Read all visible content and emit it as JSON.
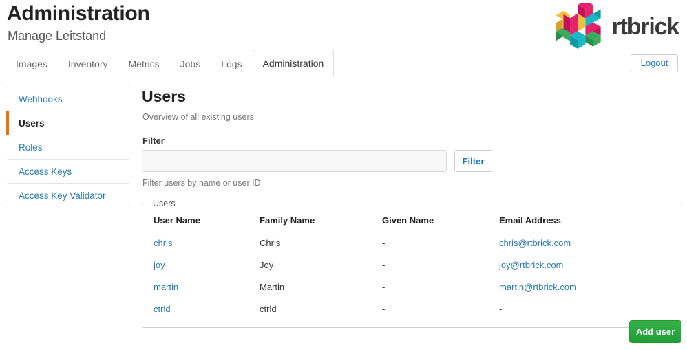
{
  "header": {
    "title": "Administration",
    "subtitle": "Manage Leitstand",
    "logout_label": "Logout"
  },
  "brand": {
    "wordmark": "rtbrick",
    "logo_icon": "rtbrick-cubes-logo",
    "colors": {
      "magenta": "#e5236b",
      "dark_magenta": "#c4105c",
      "cyan": "#18b8c8",
      "dark_cyan": "#0f9aa8",
      "yellow": "#f2c13c",
      "dark_yellow": "#d9a02c",
      "green": "#3aab5c",
      "dark_green": "#2a8f49"
    }
  },
  "tabs": [
    {
      "label": "Images",
      "active": false
    },
    {
      "label": "Inventory",
      "active": false
    },
    {
      "label": "Metrics",
      "active": false
    },
    {
      "label": "Jobs",
      "active": false
    },
    {
      "label": "Logs",
      "active": false
    },
    {
      "label": "Administration",
      "active": true
    }
  ],
  "sidebar": {
    "items": [
      {
        "label": "Webhooks",
        "active": false
      },
      {
        "label": "Users",
        "active": true
      },
      {
        "label": "Roles",
        "active": false
      },
      {
        "label": "Access Keys",
        "active": false
      },
      {
        "label": "Access Key Validator",
        "active": false
      }
    ],
    "active_marker_color": "#e8730c"
  },
  "main": {
    "title": "Users",
    "subtitle": "Overview of all existing users",
    "filter": {
      "label": "Filter",
      "value": "",
      "placeholder": "",
      "button_label": "Filter",
      "hint": "Filter users by name or user ID"
    },
    "users_panel": {
      "legend": "Users",
      "columns": [
        "User Name",
        "Family Name",
        "Given Name",
        "Email Address"
      ],
      "rows": [
        {
          "user_name": "chris",
          "family_name": "Chris",
          "given_name": "-",
          "email": "chris@rtbrick.com"
        },
        {
          "user_name": "joy",
          "family_name": "Joy",
          "given_name": "-",
          "email": "joy@rtbrick.com"
        },
        {
          "user_name": "martin",
          "family_name": "Martin",
          "given_name": "-",
          "email": "martin@rtbrick.com"
        },
        {
          "user_name": "ctrld",
          "family_name": "ctrld",
          "given_name": "-",
          "email": "-"
        }
      ]
    },
    "add_user_label": "Add user"
  }
}
